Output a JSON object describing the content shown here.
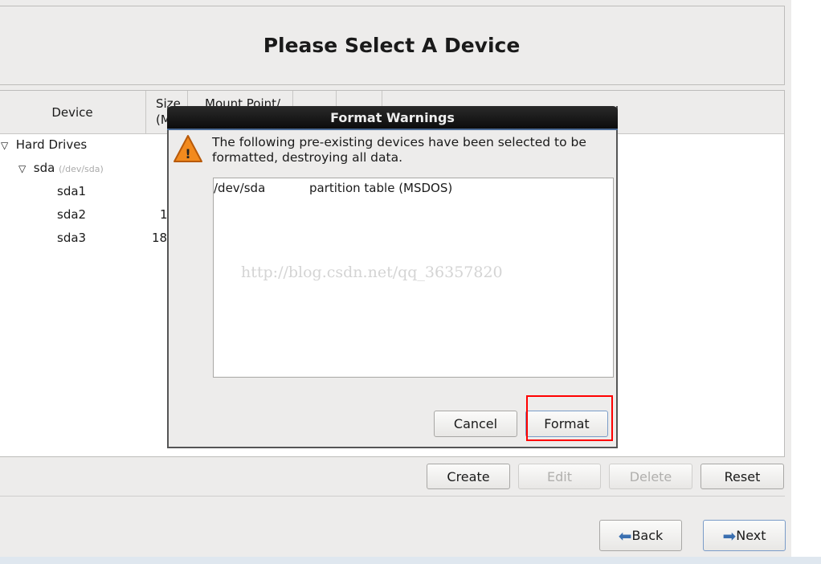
{
  "header": {
    "title": "Please Select A Device"
  },
  "table": {
    "columns": [
      "Device",
      "Size",
      "(M",
      "Mount Point/"
    ],
    "rows": [
      {
        "label": "Hard Drives",
        "size": ""
      },
      {
        "label": "sda",
        "sub": "(/dev/sda)",
        "size": ""
      },
      {
        "label": "sda1",
        "size": ""
      },
      {
        "label": "sda2",
        "size": "1"
      },
      {
        "label": "sda3",
        "size": "18"
      }
    ]
  },
  "actions": {
    "create": "Create",
    "edit": "Edit",
    "delete": "Delete",
    "reset": "Reset"
  },
  "nav": {
    "back": "Back",
    "next": "Next"
  },
  "dialog": {
    "title": "Format Warnings",
    "message": "The following pre-existing devices have been selected to be formatted, destroying all data.",
    "items": [
      {
        "device": "/dev/sda",
        "description": "partition table (MSDOS)"
      }
    ],
    "watermark": "http://blog.csdn.net/qq_36357820",
    "cancel": "Cancel",
    "format": "Format"
  },
  "colors": {
    "highlight": "#ff0000",
    "warning": "#f28a1e",
    "arrow": "#3a6fb0"
  }
}
